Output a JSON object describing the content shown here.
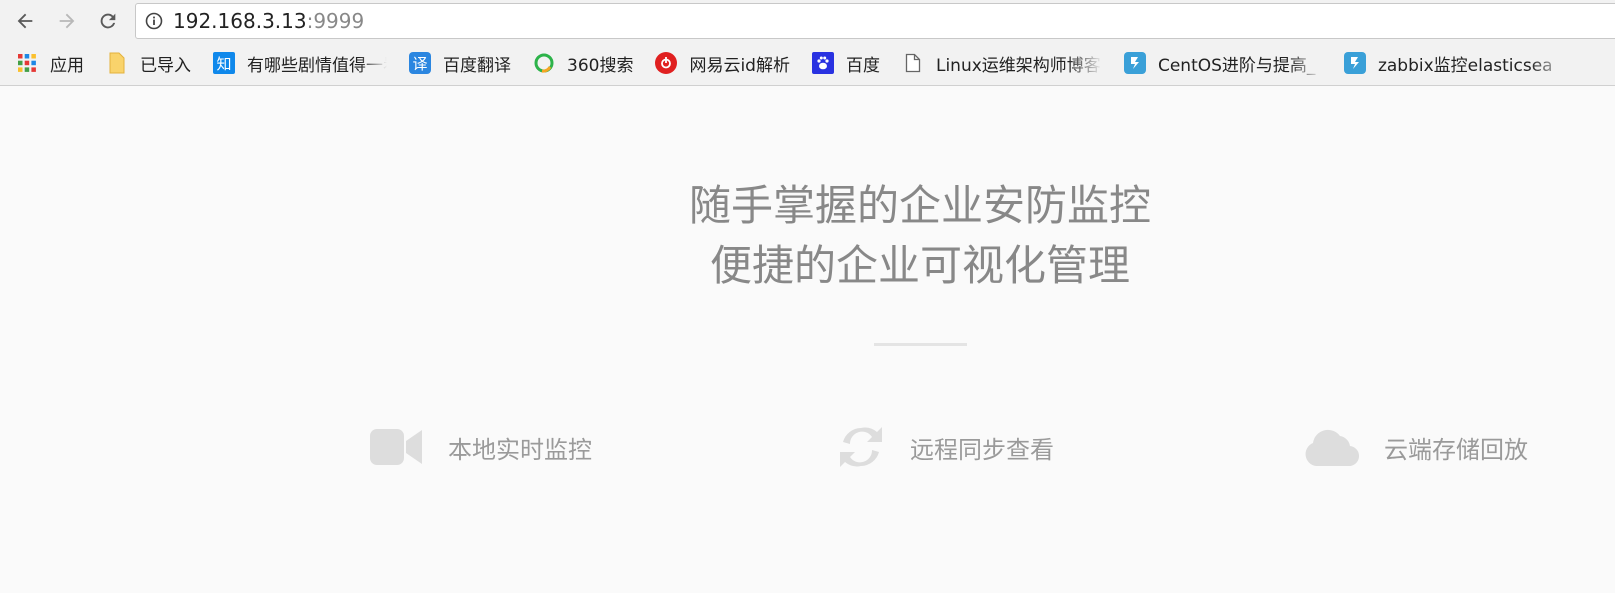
{
  "browser": {
    "url_host": "192.168.3.13",
    "url_port": ":9999"
  },
  "bookmarks": [
    {
      "label": "应用",
      "icon": "apps-grid-icon"
    },
    {
      "label": "已导入",
      "icon": "folder-icon"
    },
    {
      "label": "有哪些剧情值得一看",
      "icon": "zhihu-icon",
      "glyph": "知",
      "color": "#0f88eb"
    },
    {
      "label": "百度翻译",
      "icon": "baidu-translate-icon",
      "glyph": "译",
      "color": "#2b86e0"
    },
    {
      "label": "360搜索",
      "icon": "360-search-icon"
    },
    {
      "label": "网易云id解析",
      "icon": "netease-music-icon",
      "color": "#e02020"
    },
    {
      "label": "百度",
      "icon": "baidu-paw-icon",
      "color": "#2932e1"
    },
    {
      "label": "Linux运维架构师博客",
      "icon": "page-icon"
    },
    {
      "label": "CentOS进阶与提高_",
      "icon": "cnblogs-icon",
      "color": "#3aa0d8"
    },
    {
      "label": "zabbix监控elasticsea",
      "icon": "cnblogs-icon",
      "color": "#3aa0d8"
    }
  ],
  "hero": {
    "line1": "随手掌握的企业安防监控",
    "line2": "便捷的企业可视化管理"
  },
  "features": [
    {
      "label": "本地实时监控",
      "icon": "video-camera-icon"
    },
    {
      "label": "远程同步查看",
      "icon": "sync-icon"
    },
    {
      "label": "云端存储回放",
      "icon": "cloud-icon"
    }
  ],
  "colors": {
    "page_bg": "#fafafa",
    "hero_text": "#888888",
    "feature_icon": "#dddddd",
    "feature_text": "#9a9a9a"
  }
}
